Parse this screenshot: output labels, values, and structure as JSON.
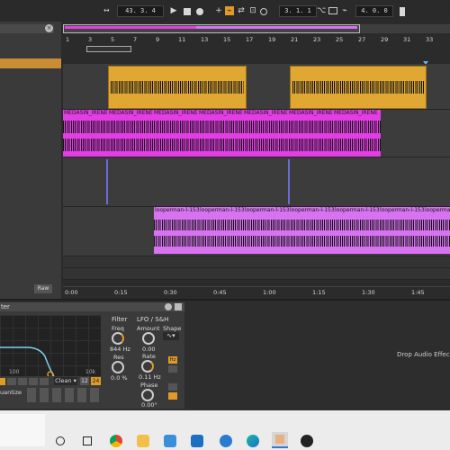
{
  "transport": {
    "song_position": "43.  3.  4",
    "loop_start": "3.  1.  1",
    "loop_length": "4.  0.  0"
  },
  "ruler": {
    "bars": [
      "1",
      "3",
      "5",
      "7",
      "9",
      "11",
      "13",
      "15",
      "17",
      "19",
      "21",
      "23",
      "25",
      "27",
      "29",
      "31",
      "33"
    ],
    "times": [
      "0:00",
      "0:15",
      "0:30",
      "0:45",
      "1:00",
      "1:15",
      "1:30",
      "1:45"
    ]
  },
  "tracks": {
    "medasin_label": "MEDASIN_IRENE",
    "looperman_label": "looperman-l-153"
  },
  "left_panel": {
    "raw_label": "Raw"
  },
  "device": {
    "title": "ter",
    "freq_axis": [
      "100",
      "10k"
    ],
    "filter_section": "Filter",
    "freq_label": "Freq",
    "freq_value": "844 Hz",
    "res_label": "Res",
    "res_value": "0.0 %",
    "lfo_title": "LFO / S&H",
    "amount_label": "Amount",
    "shape_label": "Shape",
    "amount_value": "0.00",
    "rate_label": "Rate",
    "rate_value": "0.11 Hz",
    "phase_label": "Phase",
    "phase_value": "0.00°",
    "hz_badge": "Hz",
    "clean_select": "Clean ▾",
    "slope_12": "12",
    "slope_24": "24",
    "quantize_label": "uantize",
    "drop_hint": "Drop Audio Effects H"
  },
  "colors": {
    "orange_clip": "#e0a832",
    "magenta_clip": "#e23ee4",
    "violet_clip": "#d772f0",
    "accent": "#e09a28"
  }
}
